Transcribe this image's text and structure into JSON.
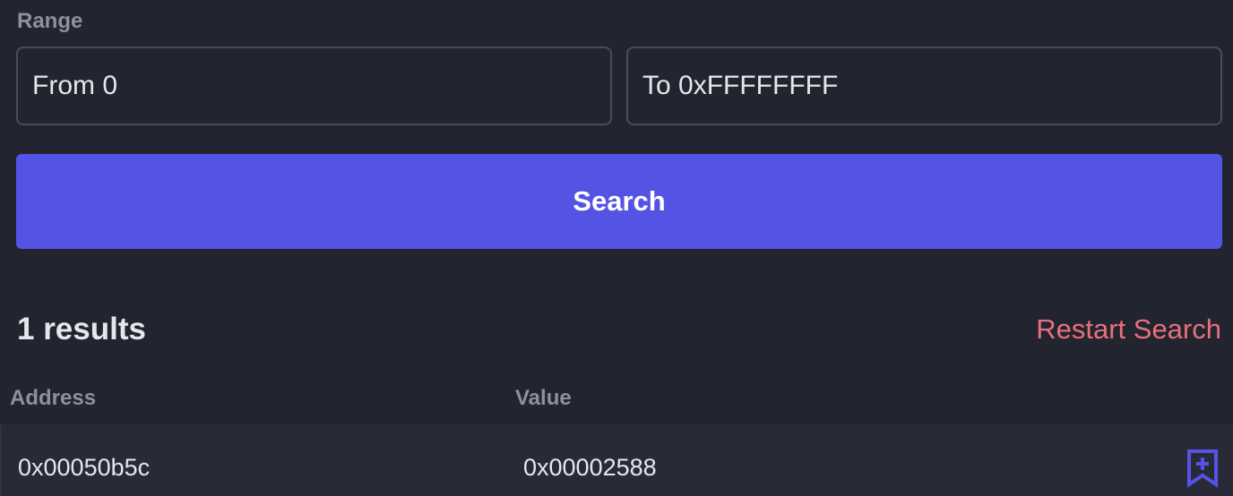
{
  "range": {
    "label": "Range",
    "from_placeholder": "From 0",
    "to_placeholder": "To 0xFFFFFFFF"
  },
  "search_label": "Search",
  "results": {
    "count_label": "1 results",
    "restart_label": "Restart Search"
  },
  "table": {
    "headers": [
      "Address",
      "Value"
    ],
    "rows": [
      {
        "address": "0x00050b5c",
        "value": "0x00002588",
        "action_icon": "bookmark-add-icon"
      }
    ]
  },
  "colors": {
    "background": "#222530",
    "accent": "#5553e4",
    "restart": "#e8707d",
    "muted_text": "#8e909b"
  }
}
